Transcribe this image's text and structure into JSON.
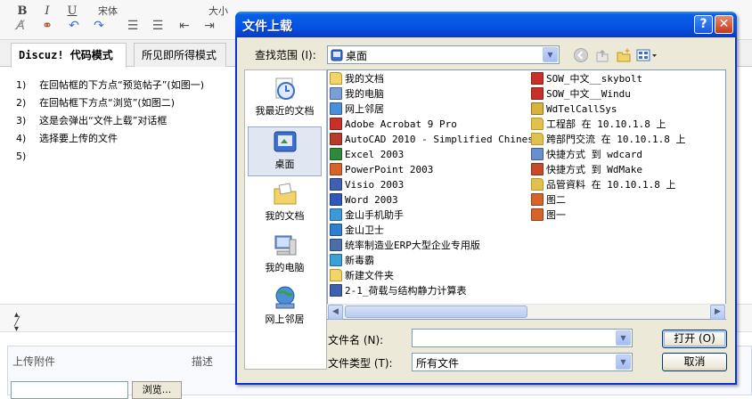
{
  "editor": {
    "toolbar": {
      "bold": "B",
      "italic": "I",
      "underline": "U",
      "font_name": "宋体",
      "font_size": "大小"
    },
    "tabs": [
      {
        "label": "Discuz! 代码模式"
      },
      {
        "label": "所见即所得模式"
      }
    ],
    "lines": [
      {
        "num": "1)",
        "text": "在回帖框的下方点“预览帖子”(如图一)"
      },
      {
        "num": "2)",
        "text": "在回帖框下方点“浏览”(如图二)"
      },
      {
        "num": "3)",
        "text": "这是会弹出“文件上载”对话框"
      },
      {
        "num": "4)",
        "text": "选择要上传的文件"
      },
      {
        "num": "5)",
        "text": ""
      }
    ]
  },
  "attachments": {
    "header": "上传附件",
    "desc_header": "描述",
    "browse_label": "浏览..."
  },
  "dialog": {
    "title": "文件上载",
    "help_glyph": "?",
    "close_glyph": "✕",
    "look_in_label": "查找范围 (I):",
    "look_in_value": "桌面",
    "places": [
      {
        "label": "我最近的文档",
        "icon": "recent-documents-icon"
      },
      {
        "label": "桌面",
        "icon": "desktop-icon"
      },
      {
        "label": "我的文档",
        "icon": "my-documents-icon"
      },
      {
        "label": "我的电脑",
        "icon": "my-computer-icon"
      },
      {
        "label": "网上邻居",
        "icon": "network-places-icon"
      }
    ],
    "files_col1": [
      {
        "name": "我的文档",
        "icon": "folder-icon",
        "color": "#f2d46a"
      },
      {
        "name": "我的电脑",
        "icon": "computer-icon",
        "color": "#7a9fd6"
      },
      {
        "name": "网上邻居",
        "icon": "network-icon",
        "color": "#4a8fd8"
      },
      {
        "name": "Adobe Acrobat 9 Pro",
        "icon": "shortcut-icon",
        "color": "#c8312a"
      },
      {
        "name": "AutoCAD 2010 - Simplified Chinese",
        "icon": "shortcut-icon",
        "color": "#b83a2a"
      },
      {
        "name": "Excel 2003",
        "icon": "shortcut-icon",
        "color": "#2e8b3c"
      },
      {
        "name": "PowerPoint 2003",
        "icon": "shortcut-icon",
        "color": "#d6642a"
      },
      {
        "name": "Visio 2003",
        "icon": "shortcut-icon",
        "color": "#3f5fb0"
      },
      {
        "name": "Word 2003",
        "icon": "shortcut-icon",
        "color": "#2f58b8"
      },
      {
        "name": "金山手机助手",
        "icon": "shortcut-icon",
        "color": "#3a9ad9"
      },
      {
        "name": "金山卫士",
        "icon": "shortcut-icon",
        "color": "#2f7fd0"
      },
      {
        "name": "统率制造业ERP大型企业专用版",
        "icon": "shortcut-icon",
        "color": "#4a6ea8"
      },
      {
        "name": "新毒霸",
        "icon": "shortcut-icon",
        "color": "#3aa0d8"
      },
      {
        "name": "新建文件夹",
        "icon": "folder-icon",
        "color": "#f2d46a"
      },
      {
        "name": "2-1_荷载与结构静力计算表",
        "icon": "document-icon",
        "color": "#3f5fb0"
      }
    ],
    "files_col2": [
      {
        "name": "SOW_中文__skybolt",
        "icon": "pdf-icon",
        "color": "#c8312a"
      },
      {
        "name": "SOW_中文__Windu",
        "icon": "pdf-icon",
        "color": "#c8312a"
      },
      {
        "name": "WdTelCallSys",
        "icon": "app-icon",
        "color": "#d8b23a"
      },
      {
        "name": "工程部 在 10.10.1.8 上",
        "icon": "network-folder-icon",
        "color": "#e0c050"
      },
      {
        "name": "跨部門交流 在 10.10.1.8 上",
        "icon": "network-folder-icon",
        "color": "#e0c050"
      },
      {
        "name": "快捷方式 到 wdcard",
        "icon": "shortcut-icon",
        "color": "#6a8fd0"
      },
      {
        "name": "快捷方式 到 WdMake",
        "icon": "shortcut-icon",
        "color": "#c84a2a"
      },
      {
        "name": "品管資料 在 10.10.1.8 上",
        "icon": "network-folder-icon",
        "color": "#e0c050"
      },
      {
        "name": "图二",
        "icon": "image-icon",
        "color": "#d6642a"
      },
      {
        "name": "图一",
        "icon": "image-icon",
        "color": "#d6642a"
      }
    ],
    "filename_label": "文件名 (N):",
    "filename_value": "",
    "filetype_label": "文件类型 (T):",
    "filetype_value": "所有文件",
    "open_label": "打开 (O)",
    "cancel_label": "取消"
  }
}
